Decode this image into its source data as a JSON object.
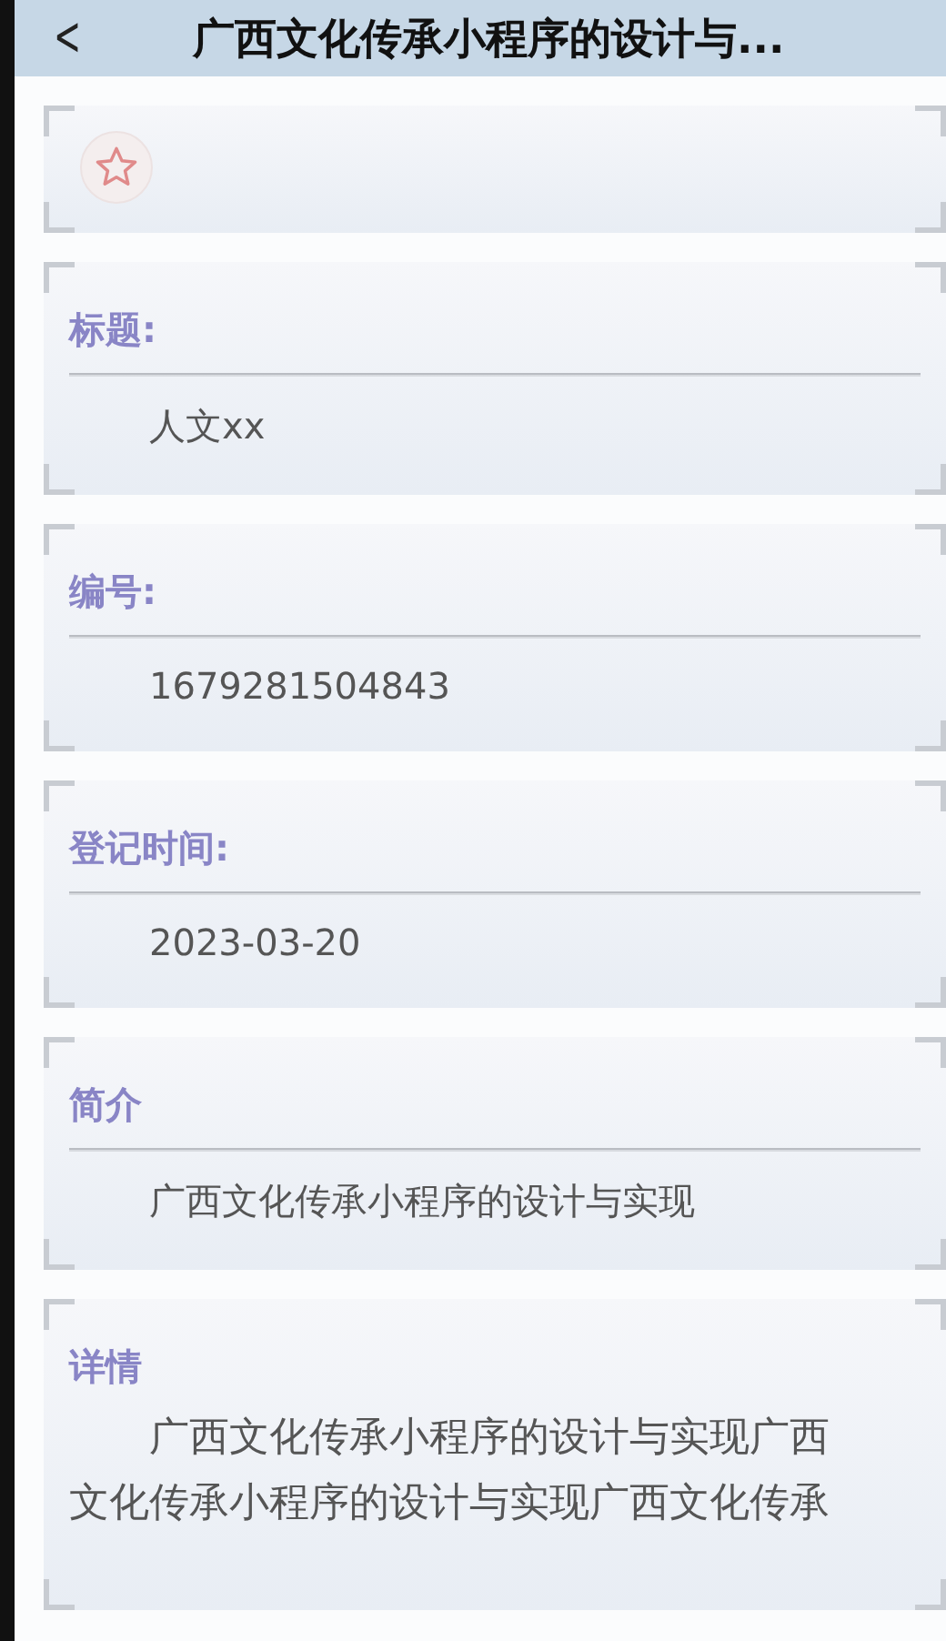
{
  "header": {
    "back": "<",
    "title": "广西文化传承小程序的设计与..."
  },
  "favorite": {
    "favorited": false
  },
  "fields": [
    {
      "label": "标题:",
      "value": "人文xx"
    },
    {
      "label": "编号:",
      "value": "1679281504843"
    },
    {
      "label": "登记时间:",
      "value": "2023-03-20"
    },
    {
      "label": "简介",
      "value": "广西文化传承小程序的设计与实现"
    }
  ],
  "detail": {
    "label": "详情",
    "text": "广西文化传承小程序的设计与实现广西文化传承小程序的设计与实现广西文化传承"
  }
}
